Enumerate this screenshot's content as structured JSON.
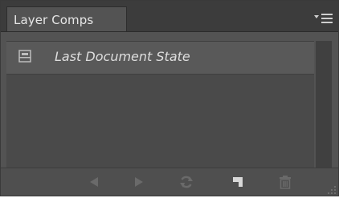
{
  "panel": {
    "tab_label": "Layer Comps",
    "menu_icon": "panel-menu-icon"
  },
  "comps": {
    "items": [
      {
        "label": "Last Document State",
        "icon": "document-state-icon"
      }
    ]
  },
  "toolbar": {
    "buttons": [
      {
        "name": "previous-comp-button",
        "icon": "triangle-left-icon"
      },
      {
        "name": "next-comp-button",
        "icon": "triangle-right-icon"
      },
      {
        "name": "update-comp-button",
        "icon": "refresh-icon"
      },
      {
        "name": "new-comp-button",
        "icon": "new-item-icon"
      },
      {
        "name": "delete-comp-button",
        "icon": "trash-icon"
      }
    ]
  },
  "colors": {
    "panel_bg": "#535353",
    "tab_bar_bg": "#3c3c3c",
    "row_bg": "#595959",
    "text": "#e6e6e6",
    "icon_dim": "#6a6a6a"
  }
}
